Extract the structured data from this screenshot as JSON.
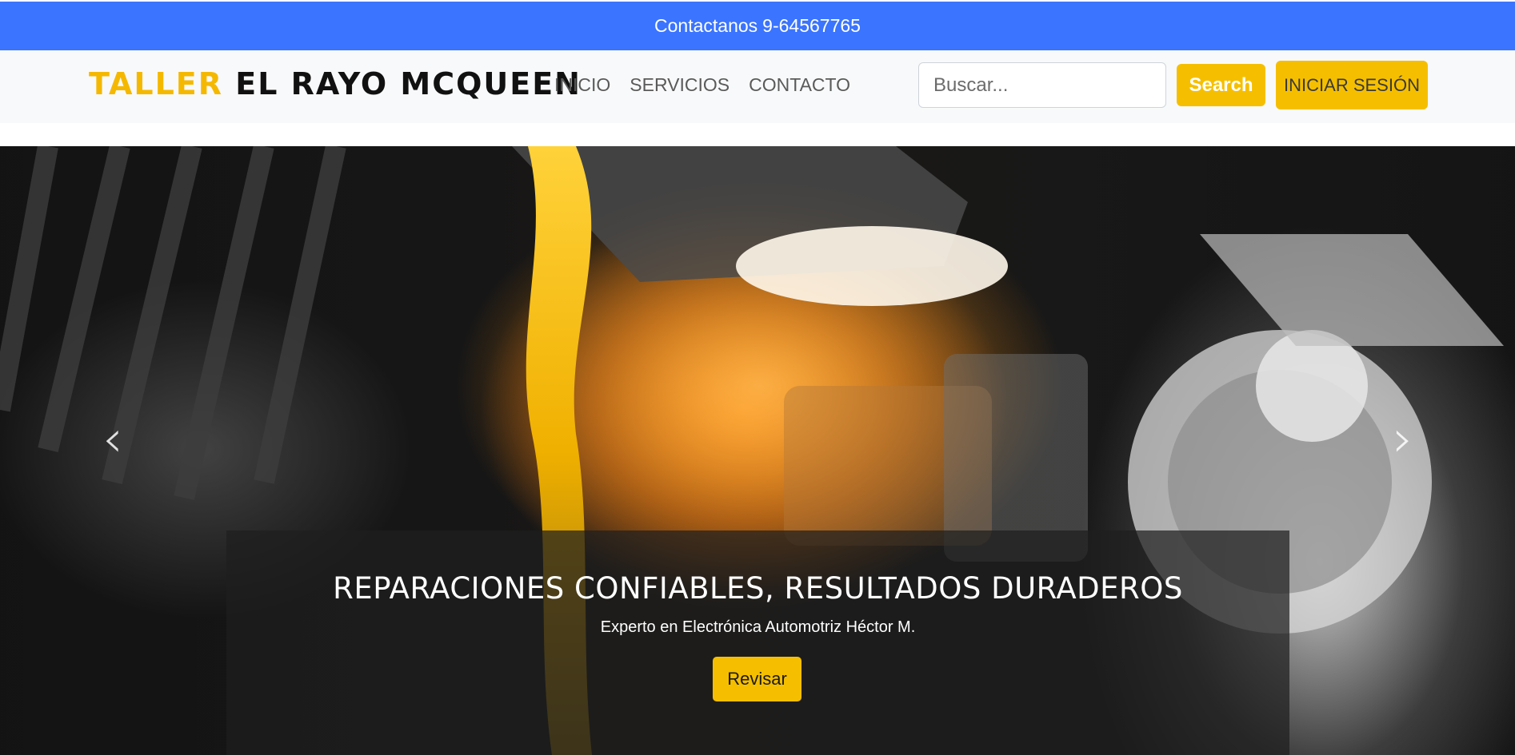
{
  "topbar": {
    "contact_label": "Contactanos",
    "phone": "9-64567765",
    "background": "#3a74ff"
  },
  "brand": {
    "part1": "TALLER",
    "part2": "EL RAYO MCQUEEN",
    "accent_color": "#f5b800"
  },
  "nav": {
    "items": [
      {
        "label": "INICIO"
      },
      {
        "label": "SERVICIOS"
      },
      {
        "label": "CONTACTO"
      }
    ]
  },
  "search": {
    "placeholder": "Buscar...",
    "value": "",
    "button_label": "Search"
  },
  "login": {
    "label": "INICIAR SESIÓN"
  },
  "carousel": {
    "prev_icon": "chevron-left-icon",
    "next_icon": "chevron-right-icon",
    "slide": {
      "title": "REPARACIONES CONFIABLES, RESULTADOS DURADEROS",
      "subtitle": "Experto en Electrónica Automotriz Héctor M.",
      "button_label": "Revisar"
    }
  },
  "colors": {
    "accent": "#f5bf00",
    "navbar_bg": "#f8f9fa"
  }
}
